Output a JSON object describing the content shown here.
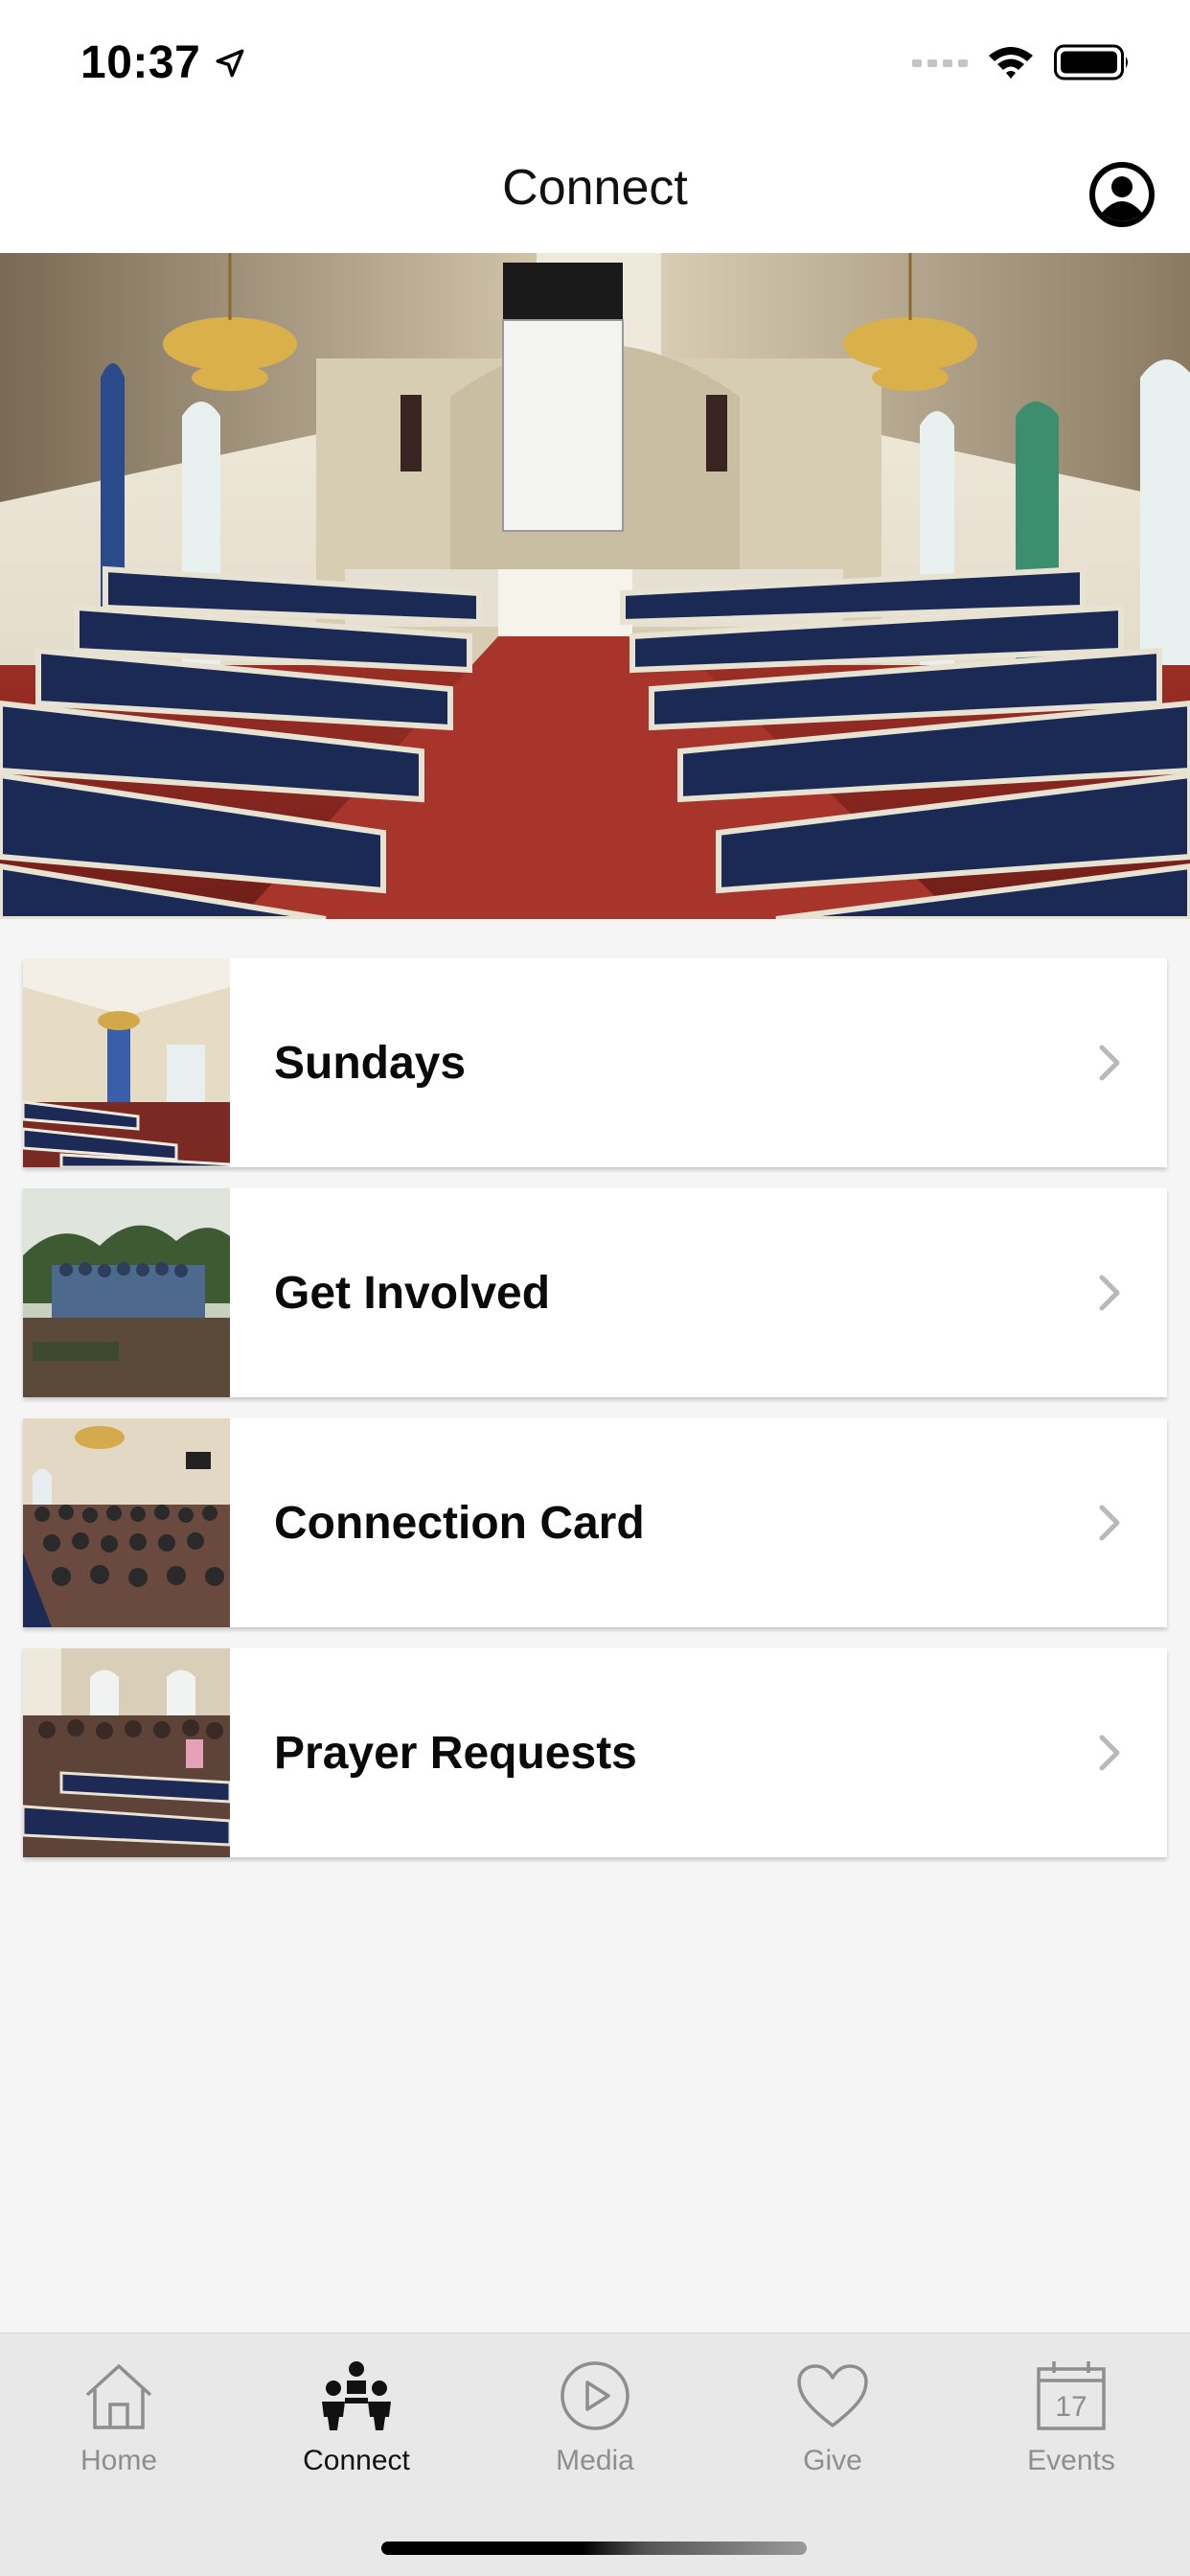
{
  "status_bar": {
    "time": "10:37",
    "icons": [
      "location-arrow-icon",
      "signal-icon",
      "wifi-icon",
      "battery-icon"
    ]
  },
  "nav": {
    "title": "Connect",
    "profile_icon": "profile-icon"
  },
  "hero": {
    "icon": "church-sanctuary-photo"
  },
  "menu": [
    {
      "label": "Sundays",
      "thumb": "sanctuary-photo"
    },
    {
      "label": "Get Involved",
      "thumb": "group-outdoors-photo"
    },
    {
      "label": "Connection Card",
      "thumb": "congregation-photo"
    },
    {
      "label": "Prayer Requests",
      "thumb": "worship-crowd-photo"
    }
  ],
  "tabs": [
    {
      "label": "Home",
      "icon": "home-icon",
      "active": false
    },
    {
      "label": "Connect",
      "icon": "people-icon",
      "active": true
    },
    {
      "label": "Media",
      "icon": "play-icon",
      "active": false
    },
    {
      "label": "Give",
      "icon": "heart-icon",
      "active": false
    },
    {
      "label": "Events",
      "icon": "calendar-icon",
      "active": false,
      "badge": "17"
    }
  ],
  "colors": {
    "background": "#f5f5f5",
    "tab_bar": "#e8e8e8",
    "active": "#111111",
    "inactive": "#8e8e8e",
    "pew_blue": "#1b2a55",
    "carpet_red": "#8e2a22"
  }
}
